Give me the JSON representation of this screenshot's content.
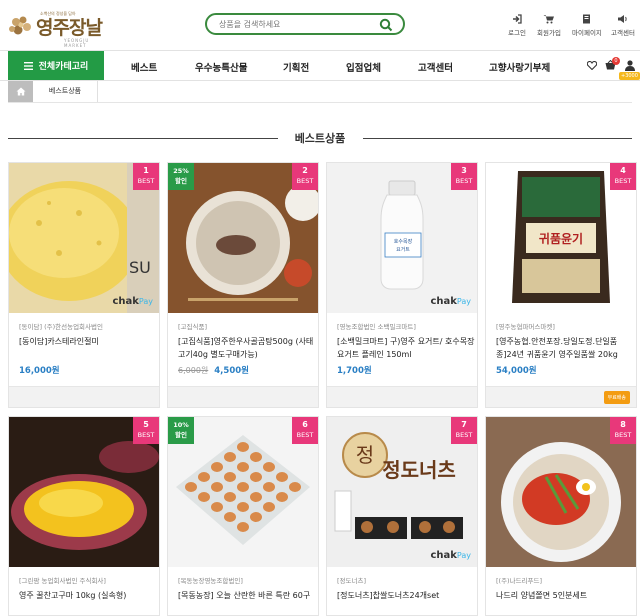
{
  "header": {
    "logo_name": "영주장날",
    "logo_tagline": "소백산의 정성을 담아",
    "logo_sub": "YEONGJU MARKET",
    "search_placeholder": "상품을 검색하세요",
    "util": [
      {
        "label": "로그인",
        "icon": "login-icon"
      },
      {
        "label": "회원가입",
        "icon": "cart-icon"
      },
      {
        "label": "마이페이지",
        "icon": "mypage-icon"
      },
      {
        "label": "고객센터",
        "icon": "speaker-icon"
      }
    ]
  },
  "nav": {
    "all_categories": "전체카테고리",
    "items": [
      "베스트",
      "우수농특산물",
      "기획전",
      "입점업체",
      "고객센터",
      "고향사랑기부제"
    ],
    "cart_count": "0",
    "save_badge": "+3000"
  },
  "breadcrumb": {
    "current": "베스트상품"
  },
  "section": {
    "title": "베스트상품"
  },
  "products": [
    {
      "rank": "1",
      "best": "BEST",
      "discount": "",
      "seller": "[동이담] (주)한선농업회사법인",
      "name": "[동이담]카스테라인절미",
      "orig_price": "",
      "price": "16,000원",
      "badge": "",
      "chak": true
    },
    {
      "rank": "2",
      "best": "BEST",
      "discount": "25%\n할인",
      "seller": "[고집식품]",
      "name": "[고집식품]영주한우사골곰탕500g (사태고기40g 별도구매가능)",
      "orig_price": "6,000원",
      "price": "4,500원",
      "badge": "",
      "chak": false
    },
    {
      "rank": "3",
      "best": "BEST",
      "discount": "",
      "seller": "[영농조합법인 소백밀크마트]",
      "name": "[소백밀크마트] 구)영주 요거트/ 호수목장 요거트 플레인 150ml",
      "orig_price": "",
      "price": "1,700원",
      "badge": "",
      "chak": true
    },
    {
      "rank": "4",
      "best": "BEST",
      "discount": "",
      "seller": "[영주농협파머스마켓]",
      "name": "[영주농협.안전포장.당일도정.단일품종]24년 귀품윤기 영주일품쌀 20kg",
      "orig_price": "",
      "price": "54,000원",
      "badge": "무료배송",
      "chak": false
    },
    {
      "rank": "5",
      "best": "BEST",
      "discount": "",
      "seller": "[그린팜 농업회사법인 주식회사]",
      "name": "영주 꿀찬고구마 10kg (실속형)",
      "orig_price": "",
      "price": "",
      "badge": "",
      "chak": false
    },
    {
      "rank": "6",
      "best": "BEST",
      "discount": "10%\n할인",
      "seller": "[목동농장영농조합법인]",
      "name": "[목동농장] 오늘 산란한 바른 특란 60구",
      "orig_price": "",
      "price": "",
      "badge": "",
      "chak": false
    },
    {
      "rank": "7",
      "best": "BEST",
      "discount": "",
      "seller": "[정도너츠]",
      "name": "[정도너츠]찹쌀도너츠24개set",
      "orig_price": "",
      "price": "",
      "badge": "",
      "chak": true
    },
    {
      "rank": "8",
      "best": "BEST",
      "discount": "",
      "seller": "[(주)나드리푸드]",
      "name": "나드리 양념쫄면 5인분세트",
      "orig_price": "",
      "price": "",
      "badge": "",
      "chak": false
    }
  ],
  "chak_text": "chak",
  "chak_pay": "Pay"
}
